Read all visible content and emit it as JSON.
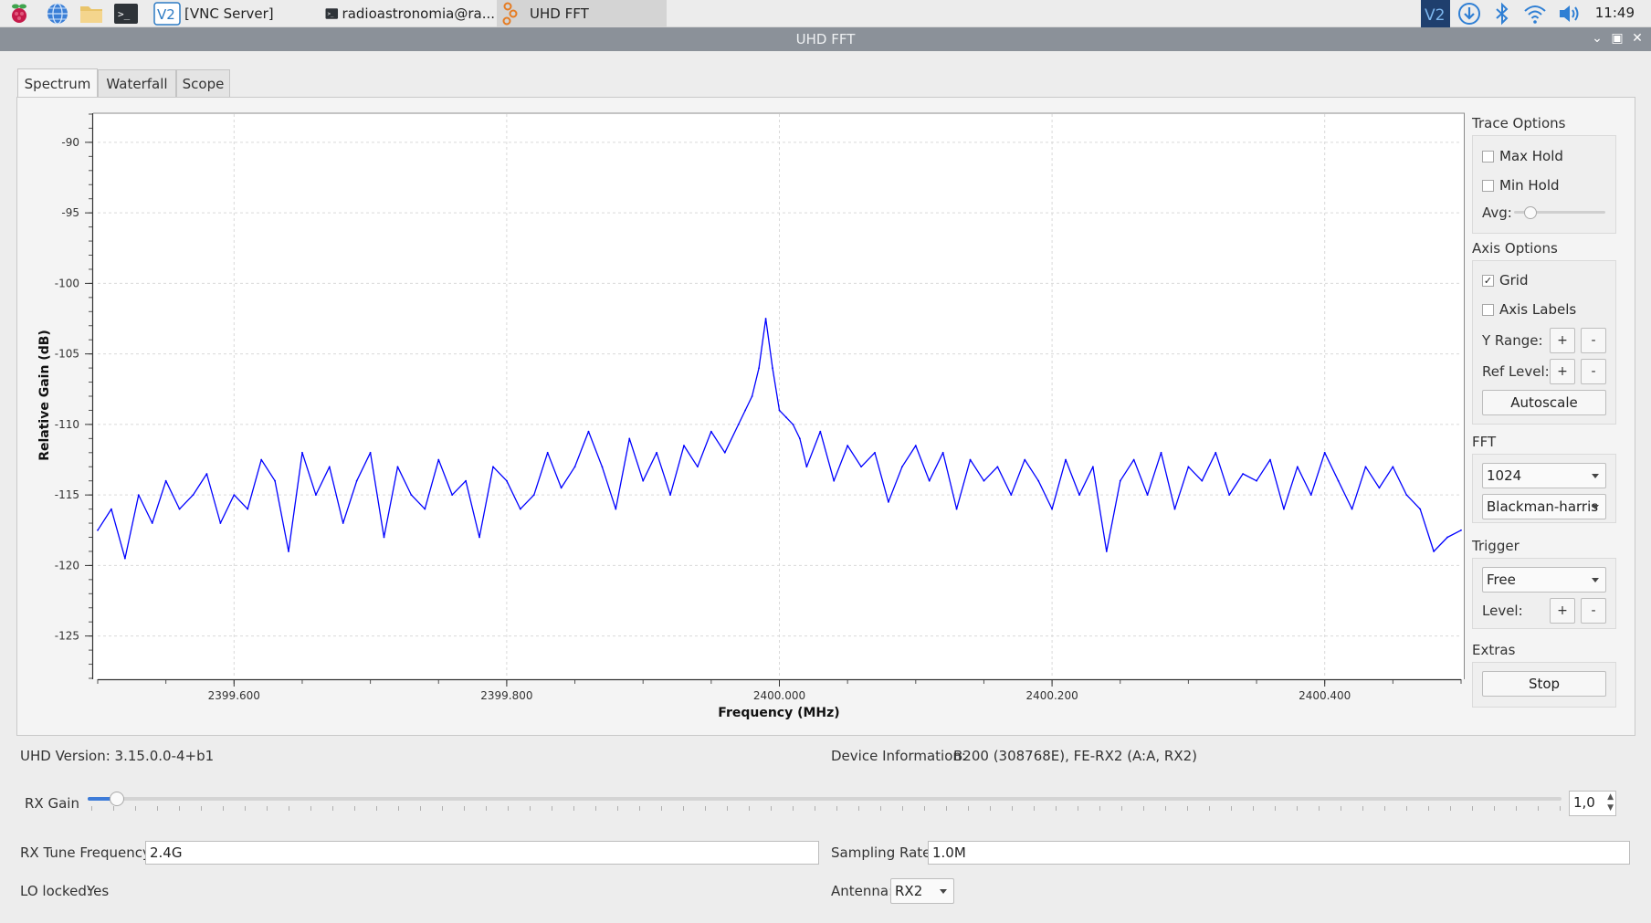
{
  "taskbar": {
    "items": [
      {
        "label": "[VNC Server]",
        "icon": "vnc-icon"
      },
      {
        "label": "radioastronomia@ra...",
        "icon": "terminal-icon"
      },
      {
        "label": "UHD FFT",
        "icon": "gnuradio-icon",
        "active": true
      }
    ],
    "launchers": [
      "raspberry-menu-icon",
      "web-browser-icon",
      "file-manager-icon",
      "terminal-icon"
    ],
    "tray": [
      "vnc-tray-icon",
      "download-icon",
      "bluetooth-icon",
      "wifi-icon",
      "volume-icon"
    ],
    "clock": "11:49"
  },
  "window": {
    "title": "UHD FFT"
  },
  "tabs": [
    {
      "label": "Spectrum",
      "active": true
    },
    {
      "label": "Waterfall",
      "active": false
    },
    {
      "label": "Scope",
      "active": false
    }
  ],
  "trace_options": {
    "title": "Trace Options",
    "max_hold": {
      "label": "Max Hold",
      "checked": false
    },
    "min_hold": {
      "label": "Min Hold",
      "checked": false
    },
    "avg_label": "Avg:",
    "avg_level": 0.1
  },
  "axis_options": {
    "title": "Axis Options",
    "grid": {
      "label": "Grid",
      "checked": true,
      "mark": "✓"
    },
    "axis_labels": {
      "label": "Axis Labels",
      "checked": false
    },
    "y_range_label": "Y Range:",
    "ref_level_label": "Ref Level:",
    "plus": "+",
    "minus": "-",
    "autoscale": "Autoscale"
  },
  "fft": {
    "title": "FFT",
    "size": "1024",
    "window": "Blackman-harris"
  },
  "trigger": {
    "title": "Trigger",
    "mode": "Free",
    "level_label": "Level:"
  },
  "extras": {
    "title": "Extras",
    "stop": "Stop"
  },
  "info": {
    "uhd_version": "UHD Version: 3.15.0.0-4+b1",
    "device_information_label": "Device Information:",
    "device_information": "B200 (308768E), FE-RX2 (A:A, RX2)"
  },
  "rx_gain": {
    "label": "RX Gain",
    "value": "1,0",
    "level": 0.01
  },
  "rx_tune": {
    "label": "RX Tune Frequency:",
    "value": "2.4G"
  },
  "sampling_rate": {
    "label": "Sampling Rate:",
    "value": "1.0M"
  },
  "lo_locked": {
    "label": "LO locked:",
    "value": "Yes"
  },
  "antenna": {
    "label": "Antenna:",
    "value": "RX2"
  },
  "colors": {
    "trace": "#0000ff",
    "titlebar": "#8b9199",
    "accent": "#3d7bd8"
  },
  "chart_data": {
    "type": "line",
    "xlabel": "Frequency (MHz)",
    "ylabel": "Relative Gain (dB)",
    "xlim": [
      2399.5,
      2400.5
    ],
    "ylim": [
      -128,
      -88
    ],
    "x_ticks": [
      "2399.600",
      "2399.800",
      "2400.000",
      "2400.200",
      "2400.400"
    ],
    "y_ticks": [
      "-90",
      "-95",
      "-100",
      "-105",
      "-110",
      "-115",
      "-120",
      "-125"
    ],
    "grid": true,
    "series": [
      {
        "color": "#0000ff",
        "x": [
          2399.5,
          2399.51,
          2399.52,
          2399.53,
          2399.54,
          2399.55,
          2399.56,
          2399.57,
          2399.58,
          2399.59,
          2399.6,
          2399.61,
          2399.62,
          2399.63,
          2399.64,
          2399.65,
          2399.66,
          2399.67,
          2399.68,
          2399.69,
          2399.7,
          2399.71,
          2399.72,
          2399.73,
          2399.74,
          2399.75,
          2399.76,
          2399.77,
          2399.78,
          2399.79,
          2399.8,
          2399.81,
          2399.82,
          2399.83,
          2399.84,
          2399.85,
          2399.86,
          2399.87,
          2399.88,
          2399.89,
          2399.9,
          2399.91,
          2399.92,
          2399.93,
          2399.94,
          2399.95,
          2399.96,
          2399.97,
          2399.975,
          2399.98,
          2399.985,
          2399.99,
          2399.995,
          2400.0,
          2400.005,
          2400.01,
          2400.015,
          2400.02,
          2400.03,
          2400.04,
          2400.05,
          2400.06,
          2400.07,
          2400.08,
          2400.09,
          2400.1,
          2400.11,
          2400.12,
          2400.13,
          2400.14,
          2400.15,
          2400.16,
          2400.17,
          2400.18,
          2400.19,
          2400.2,
          2400.21,
          2400.22,
          2400.23,
          2400.24,
          2400.25,
          2400.26,
          2400.27,
          2400.28,
          2400.29,
          2400.3,
          2400.31,
          2400.32,
          2400.33,
          2400.34,
          2400.35,
          2400.36,
          2400.37,
          2400.38,
          2400.39,
          2400.4,
          2400.41,
          2400.42,
          2400.43,
          2400.44,
          2400.45,
          2400.46,
          2400.47,
          2400.48,
          2400.49,
          2400.5
        ],
        "y": [
          -117.5,
          -116,
          -119.5,
          -115,
          -117,
          -114,
          -116,
          -115,
          -113.5,
          -117,
          -115,
          -116,
          -112.5,
          -114,
          -119,
          -112,
          -115,
          -113,
          -117,
          -114,
          -112,
          -118,
          -113,
          -115,
          -116,
          -112.5,
          -115,
          -114,
          -118,
          -113,
          -114,
          -116,
          -115,
          -112,
          -114.5,
          -113,
          -110.5,
          -113,
          -116,
          -111,
          -114,
          -112,
          -115,
          -111.5,
          -113,
          -110.5,
          -112,
          -110,
          -109,
          -108,
          -106,
          -102.5,
          -106,
          -109,
          -109.5,
          -110,
          -111,
          -113,
          -110.5,
          -114,
          -111.5,
          -113,
          -112,
          -115.5,
          -113,
          -111.5,
          -114,
          -112,
          -116,
          -112.5,
          -114,
          -113,
          -115,
          -112.5,
          -114,
          -116,
          -112.5,
          -115,
          -113,
          -119,
          -114,
          -112.5,
          -115,
          -112,
          -116,
          -113,
          -114,
          -112,
          -115,
          -113.5,
          -114,
          -112.5,
          -116,
          -113,
          -115,
          -112,
          -114,
          -116,
          -113,
          -114.5,
          -113,
          -115,
          -116,
          -119,
          -118,
          -117.5
        ]
      }
    ]
  }
}
